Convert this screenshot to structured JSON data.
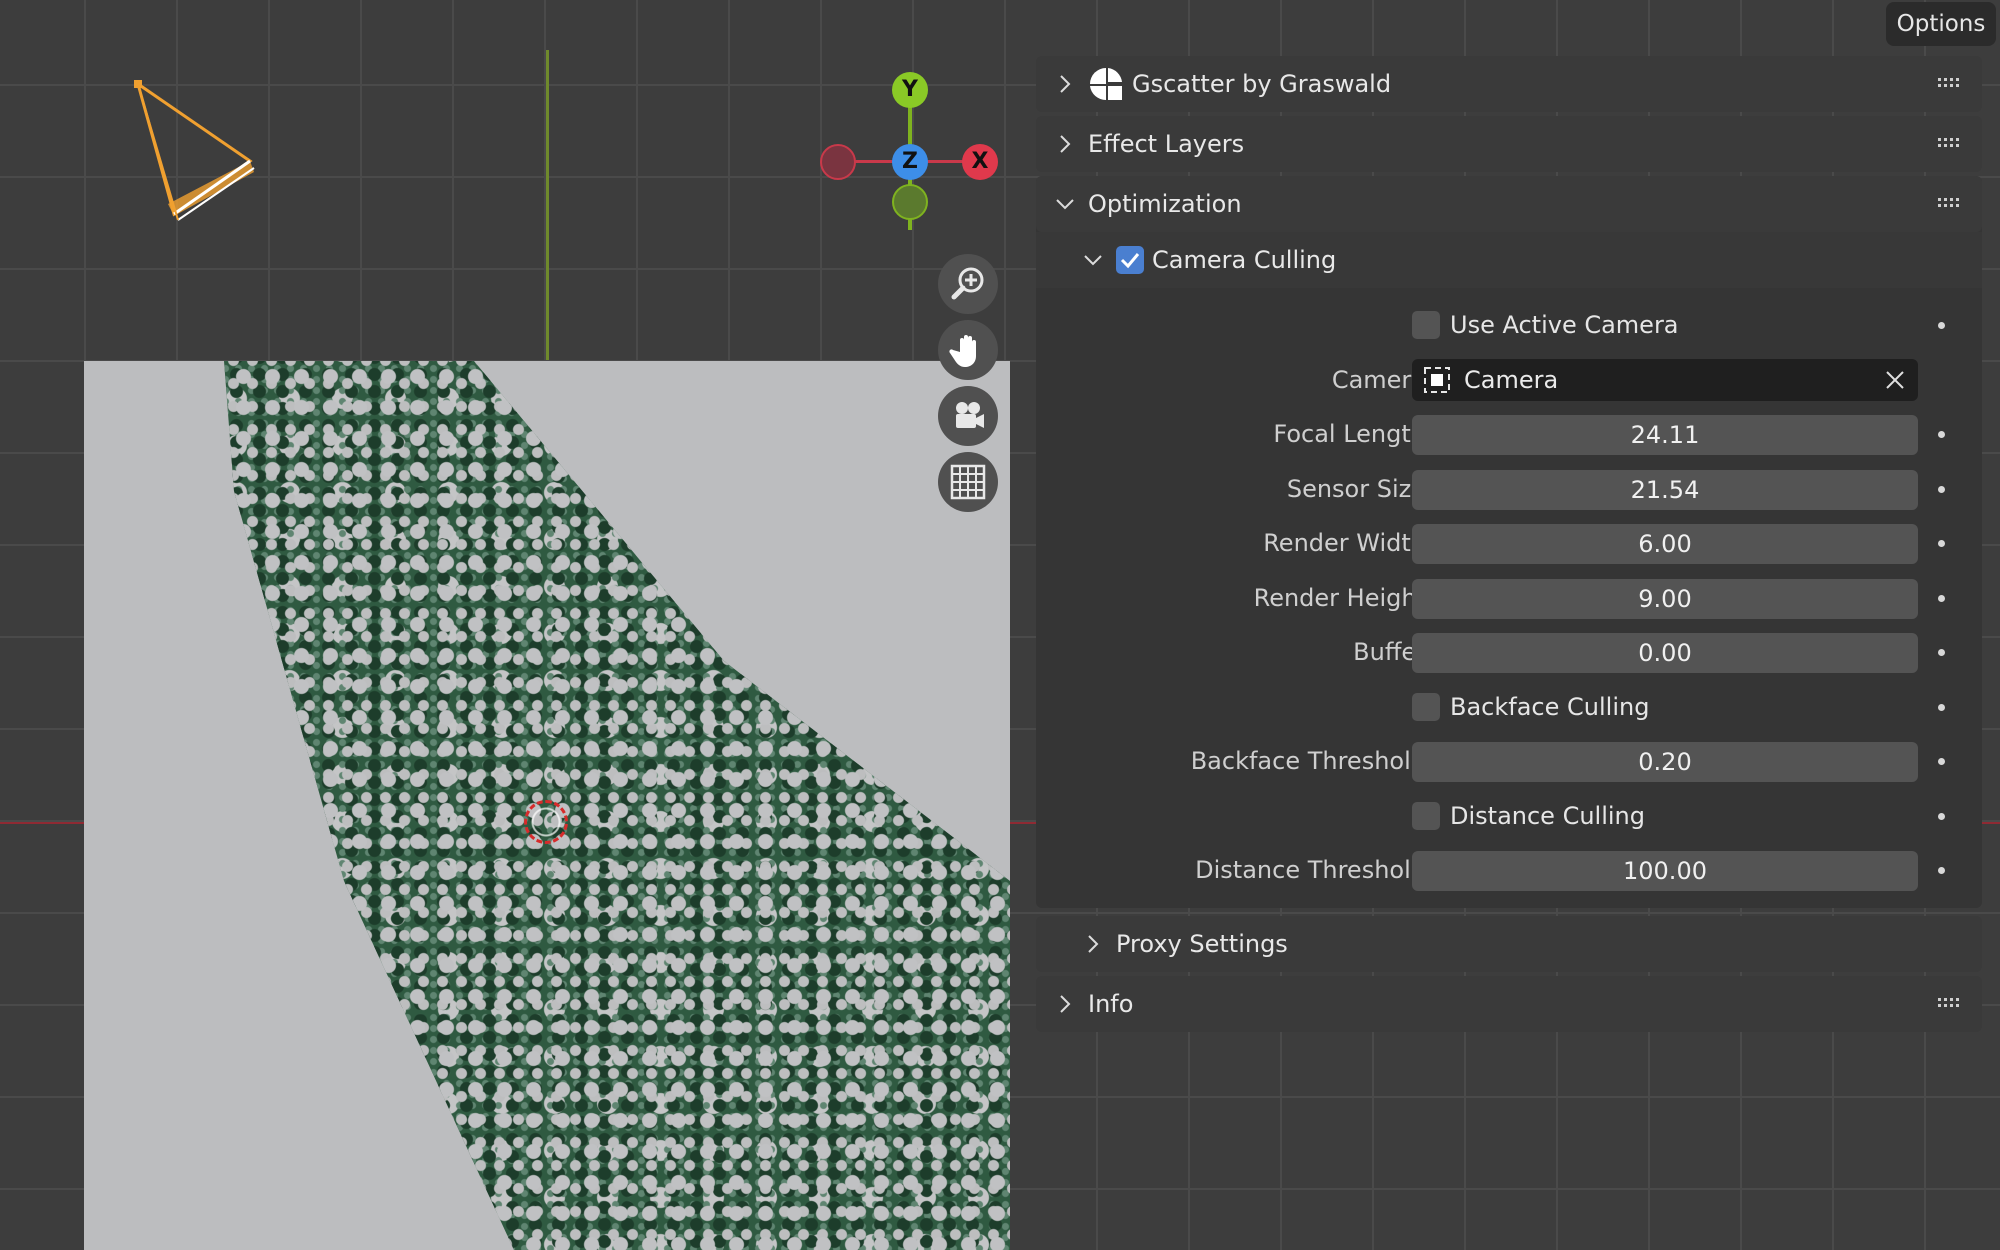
{
  "viewport": {
    "gizmo": {
      "y": "Y",
      "z": "Z",
      "x": "X"
    },
    "tools": [
      "zoom-icon",
      "hand-pan-icon",
      "camera-view-icon",
      "grid-ortho-icon"
    ]
  },
  "header": {
    "options_label": "Options"
  },
  "panel": {
    "sections": {
      "gscatter": "Gscatter by Graswald",
      "effect_layers": "Effect Layers",
      "optimization": "Optimization",
      "proxy_settings": "Proxy Settings",
      "info": "Info"
    },
    "camera_culling": {
      "label": "Camera Culling",
      "enabled": true,
      "use_active_camera": {
        "label": "Use Active Camera",
        "checked": false
      },
      "camera": {
        "label": "Camera",
        "value": "Camera"
      },
      "focal_length": {
        "label": "Focal Length",
        "value": "24.11"
      },
      "sensor_size": {
        "label": "Sensor Size",
        "value": "21.54"
      },
      "render_width": {
        "label": "Render Width",
        "value": "6.00"
      },
      "render_height": {
        "label": "Render Height",
        "value": "9.00"
      },
      "buffer": {
        "label": "Buffer",
        "value": "0.00"
      },
      "backface_culling": {
        "label": "Backface Culling",
        "checked": false
      },
      "backface_threshold": {
        "label": "Backface Threshold",
        "value": "0.20"
      },
      "distance_culling": {
        "label": "Distance Culling",
        "checked": false
      },
      "distance_threshold": {
        "label": "Distance Threshold",
        "value": "100.00"
      }
    }
  },
  "colors": {
    "accent": "#4a7fd0",
    "x_axis": "#e0394c",
    "y_axis": "#7fb31f",
    "z_axis": "#3d8ee8"
  }
}
